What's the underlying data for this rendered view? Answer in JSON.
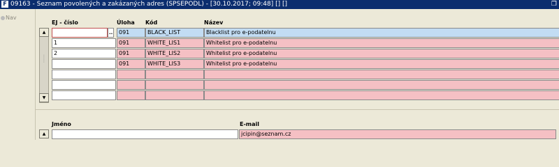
{
  "window": {
    "title": "09163 - Seznam povolených a zakázaných adres (SPSEPODL) - [30.10.2017; 09:48]  [] []",
    "app_icon": "app-icon",
    "restore_icon": "restore-icon"
  },
  "nav": {
    "label": "Nav"
  },
  "grid": {
    "headers": {
      "ej": "EJ - číslo",
      "uloha": "Úloha",
      "kod": "Kód",
      "nazev": "Název"
    },
    "rows": [
      {
        "ej": "",
        "uloha": "091",
        "kod": "BLACK_LIST",
        "nazev": "Blacklist pro e-podatelnu"
      },
      {
        "ej": "1",
        "uloha": "091",
        "kod": "WHITE_LIS1",
        "nazev": "Whitelist pro e-podatelnu"
      },
      {
        "ej": "2",
        "uloha": "091",
        "kod": "WHITE_LIS2",
        "nazev": "Whitelist pro e-podatelnu"
      },
      {
        "ej": "",
        "uloha": "091",
        "kod": "WHITE_LIS3",
        "nazev": "Whitelist pro e-podatelnu"
      },
      {
        "ej": "",
        "uloha": "",
        "kod": "",
        "nazev": ""
      },
      {
        "ej": "",
        "uloha": "",
        "kod": "",
        "nazev": ""
      },
      {
        "ej": "",
        "uloha": "",
        "kod": "",
        "nazev": ""
      }
    ],
    "lookup_button": "..."
  },
  "detail": {
    "headers": {
      "jmeno": "Jméno",
      "email": "E-mail"
    },
    "row": {
      "jmeno": "",
      "email": "jcipin@seznam.cz"
    }
  },
  "colors": {
    "titlebar": "#0b2d6e",
    "required": "#f5c0c4",
    "selected": "#c2dcf3",
    "background": "#ece9d8"
  }
}
